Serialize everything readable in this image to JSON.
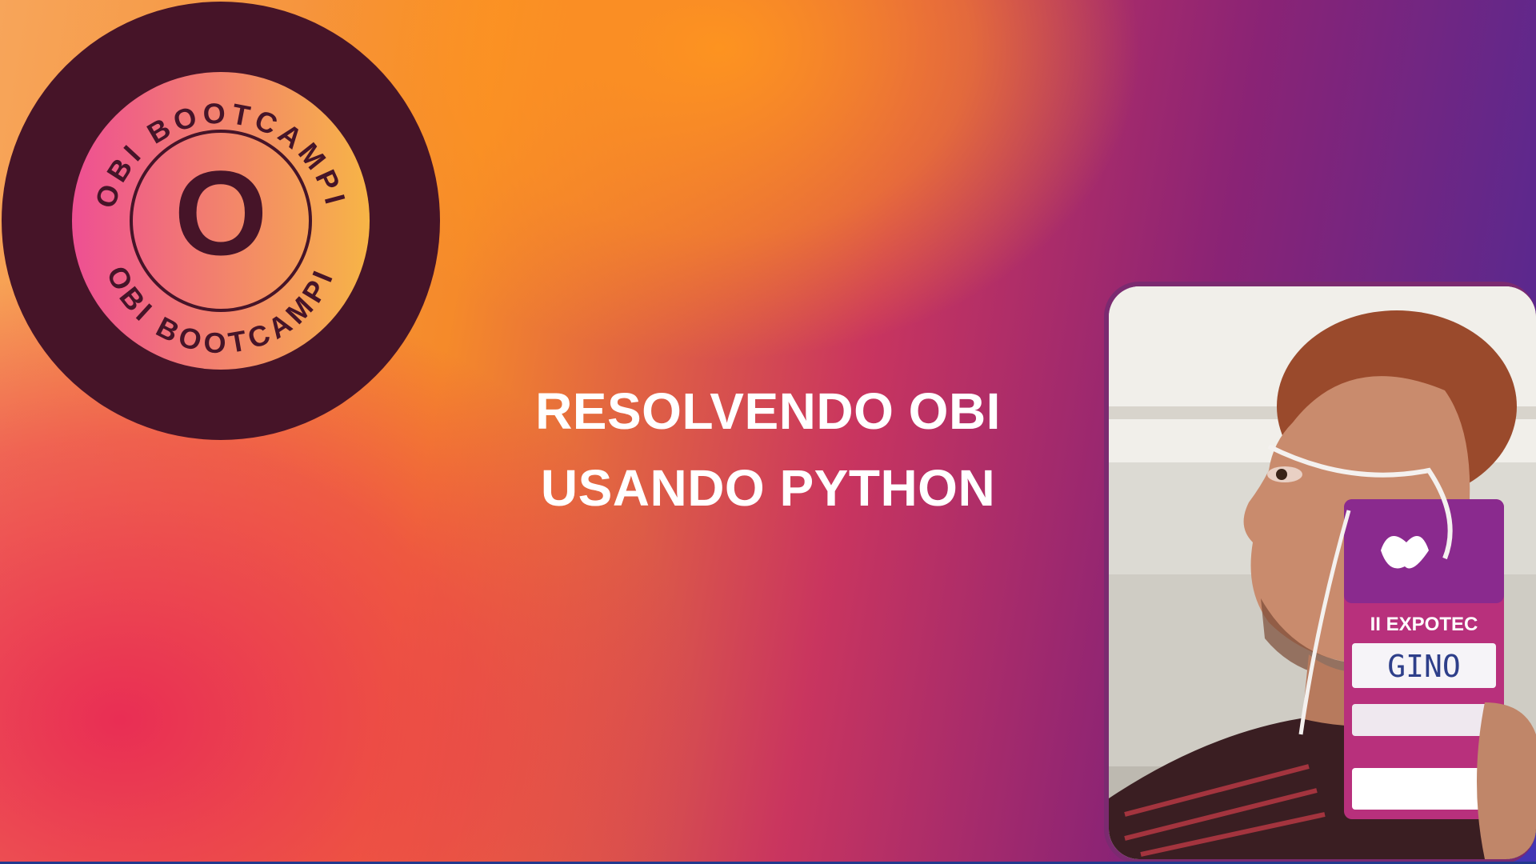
{
  "badge": {
    "letter": "O",
    "ring_text_top": "OBI BOOTCAMPI",
    "ring_text_bottom": "OBI BOOTCAMPI",
    "colors": {
      "outer": "#461428",
      "inner_from": "#ee4f93",
      "inner_to": "#f7b546"
    }
  },
  "title": {
    "line1": "RESOLVENDO OBI",
    "line2": "USANDO PYTHON"
  },
  "photo": {
    "badge_event": "II EXPOTEC",
    "badge_name": "GINO"
  },
  "colors": {
    "orange": "#f58a2a",
    "pink": "#e8285a",
    "purple": "#8a2375",
    "blue": "#4c2a96"
  }
}
